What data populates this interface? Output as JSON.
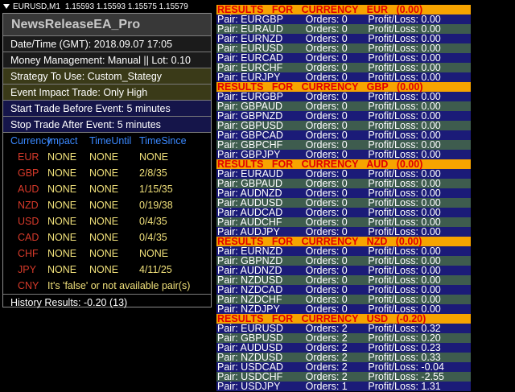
{
  "chart_header": {
    "symbol": "EURUSD,M1",
    "prices": "1.15593 1.15593 1.15575 1.15579"
  },
  "panel": {
    "title": "NewsReleaseEA_Pro",
    "datetime": "Date/Time (GMT): 2018.09.07 17:05",
    "money_management": "Money Management: Manual || Lot: 0.10",
    "strategy": "Strategy To Use: Custom_Stategy",
    "event_impact": "Event Impact Trade: Only High",
    "start_before": "Start Trade Before Event: 5 minutes",
    "stop_after": "Stop  Trade  After  Event: 5 minutes",
    "columns": [
      "Currency",
      "Impact",
      "TimeUntil",
      "TimeSince"
    ],
    "rows": [
      {
        "currency": "EUR",
        "impact": "NONE",
        "until": "NONE",
        "since": "NONE"
      },
      {
        "currency": "GBP",
        "impact": "NONE",
        "until": "NONE",
        "since": "2/8/35"
      },
      {
        "currency": "AUD",
        "impact": "NONE",
        "until": "NONE",
        "since": "1/15/35"
      },
      {
        "currency": "NZD",
        "impact": "NONE",
        "until": "NONE",
        "since": "0/19/38"
      },
      {
        "currency": "USD",
        "impact": "NONE",
        "until": "NONE",
        "since": "0/4/35"
      },
      {
        "currency": "CAD",
        "impact": "NONE",
        "until": "NONE",
        "since": "0/4/35"
      },
      {
        "currency": "CHF",
        "impact": "NONE",
        "until": "NONE",
        "since": "NONE"
      },
      {
        "currency": "JPY",
        "impact": "NONE",
        "until": "NONE",
        "since": "4/11/25"
      }
    ],
    "cny": {
      "currency": "CNY",
      "note": "It's 'false' or not available pair(s)"
    },
    "history": "History Results: -0.20   (13)"
  },
  "results": [
    {
      "header": "RESULTS   FOR   CURRENCY   EUR   (0.00)",
      "rows": [
        {
          "pair": "Pair: EURGBP",
          "orders": "Orders: 0",
          "pl": "Profit/Loss: 0.00"
        },
        {
          "pair": "Pair: EURAUD",
          "orders": "Orders: 0",
          "pl": "Profit/Loss: 0.00"
        },
        {
          "pair": "Pair: EURNZD",
          "orders": "Orders: 0",
          "pl": "Profit/Loss: 0.00"
        },
        {
          "pair": "Pair: EURUSD",
          "orders": "Orders: 0",
          "pl": "Profit/Loss: 0.00"
        },
        {
          "pair": "Pair: EURCAD",
          "orders": "Orders: 0",
          "pl": "Profit/Loss: 0.00"
        },
        {
          "pair": "Pair: EURCHF",
          "orders": "Orders: 0",
          "pl": "Profit/Loss: 0.00"
        },
        {
          "pair": "Pair: EURJPY",
          "orders": "Orders: 0",
          "pl": "Profit/Loss: 0.00"
        }
      ]
    },
    {
      "header": "RESULTS   FOR   CURRENCY   GBP   (0.00)",
      "rows": [
        {
          "pair": "Pair: EURGBP",
          "orders": "Orders: 0",
          "pl": "Profit/Loss: 0.00"
        },
        {
          "pair": "Pair: GBPAUD",
          "orders": "Orders: 0",
          "pl": "Profit/Loss: 0.00"
        },
        {
          "pair": "Pair: GBPNZD",
          "orders": "Orders: 0",
          "pl": "Profit/Loss: 0.00"
        },
        {
          "pair": "Pair: GBPUSD",
          "orders": "Orders: 0",
          "pl": "Profit/Loss: 0.00"
        },
        {
          "pair": "Pair: GBPCAD",
          "orders": "Orders: 0",
          "pl": "Profit/Loss: 0.00"
        },
        {
          "pair": "Pair: GBPCHF",
          "orders": "Orders: 0",
          "pl": "Profit/Loss: 0.00"
        },
        {
          "pair": "Pair: GBPJPY",
          "orders": "Orders: 0",
          "pl": "Profit/Loss: 0.00"
        }
      ]
    },
    {
      "header": "RESULTS   FOR   CURRENCY   AUD   (0.00)",
      "rows": [
        {
          "pair": "Pair: EURAUD",
          "orders": "Orders: 0",
          "pl": "Profit/Loss: 0.00"
        },
        {
          "pair": "Pair: GBPAUD",
          "orders": "Orders: 0",
          "pl": "Profit/Loss: 0.00"
        },
        {
          "pair": "Pair: AUDNZD",
          "orders": "Orders: 0",
          "pl": "Profit/Loss: 0.00"
        },
        {
          "pair": "Pair: AUDUSD",
          "orders": "Orders: 0",
          "pl": "Profit/Loss: 0.00"
        },
        {
          "pair": "Pair: AUDCAD",
          "orders": "Orders: 0",
          "pl": "Profit/Loss: 0.00"
        },
        {
          "pair": "Pair: AUDCHF",
          "orders": "Orders: 0",
          "pl": "Profit/Loss: 0.00"
        },
        {
          "pair": "Pair: AUDJPY",
          "orders": "Orders: 0",
          "pl": "Profit/Loss: 0.00"
        }
      ]
    },
    {
      "header": "RESULTS   FOR   CURRENCY   NZD   (0.00)",
      "rows": [
        {
          "pair": "Pair: EURNZD",
          "orders": "Orders: 0",
          "pl": "Profit/Loss: 0.00"
        },
        {
          "pair": "Pair: GBPNZD",
          "orders": "Orders: 0",
          "pl": "Profit/Loss: 0.00"
        },
        {
          "pair": "Pair: AUDNZD",
          "orders": "Orders: 0",
          "pl": "Profit/Loss: 0.00"
        },
        {
          "pair": "Pair: NZDUSD",
          "orders": "Orders: 0",
          "pl": "Profit/Loss: 0.00"
        },
        {
          "pair": "Pair: NZDCAD",
          "orders": "Orders: 0",
          "pl": "Profit/Loss: 0.00"
        },
        {
          "pair": "Pair: NZDCHF",
          "orders": "Orders: 0",
          "pl": "Profit/Loss: 0.00"
        },
        {
          "pair": "Pair: NZDJPY",
          "orders": "Orders: 0",
          "pl": "Profit/Loss: 0.00"
        }
      ]
    },
    {
      "header": "RESULTS   FOR   CURRENCY   USD   (-0.20)",
      "rows": [
        {
          "pair": "Pair: EURUSD",
          "orders": "Orders: 2",
          "pl": "Profit/Loss: 0.32"
        },
        {
          "pair": "Pair: GBPUSD",
          "orders": "Orders: 2",
          "pl": "Profit/Loss: 0.20"
        },
        {
          "pair": "Pair: AUDUSD",
          "orders": "Orders: 2",
          "pl": "Profit/Loss: 0.23"
        },
        {
          "pair": "Pair: NZDUSD",
          "orders": "Orders: 2",
          "pl": "Profit/Loss: 0.33"
        },
        {
          "pair": "Pair: USDCAD",
          "orders": "Orders: 2",
          "pl": "Profit/Loss: -0.04"
        },
        {
          "pair": "Pair: USDCHF",
          "orders": "Orders: 2",
          "pl": "Profit/Loss: -2.55"
        },
        {
          "pair": "Pair: USDJPY",
          "orders": "Orders: 1",
          "pl": "Profit/Loss: 1.31"
        }
      ]
    }
  ]
}
